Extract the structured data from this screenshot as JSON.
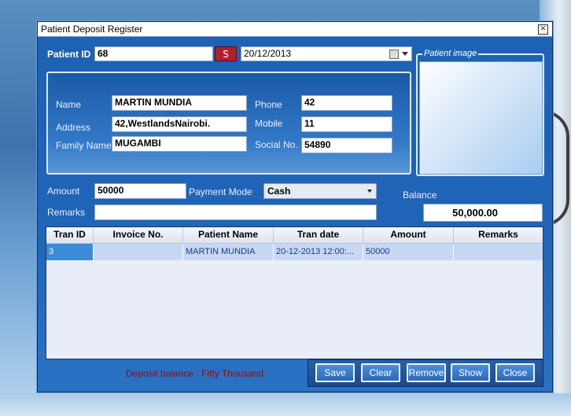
{
  "window": {
    "title": "Patient Deposit Register"
  },
  "header": {
    "patient_id_label": "Patient ID",
    "patient_id_value": "68",
    "search_button": "S",
    "date_value": "20/12/2013"
  },
  "patient": {
    "name_label": "Name",
    "name_value": "MARTIN MUNDIA",
    "address_label": "Address",
    "address_value": "42,WestlandsNairobi.",
    "family_label": "Family Name",
    "family_value": "MUGAMBI",
    "phone_label": "Phone",
    "phone_value": "42",
    "mobile_label": "Mobile",
    "mobile_value": "11",
    "social_label": "Social No.",
    "social_value": "54890"
  },
  "image_group": {
    "legend": "Patient image"
  },
  "payment": {
    "amount_label": "Amount",
    "amount_value": "50000",
    "mode_label": "Payment Mode",
    "mode_value": "Cash",
    "remarks_label": "Remarks",
    "remarks_value": "",
    "balance_label": "Balance",
    "balance_value": "50,000.00"
  },
  "grid": {
    "columns": [
      "Tran ID",
      "Invoice No.",
      "Patient Name",
      "Tran date",
      "Amount",
      "Remarks"
    ],
    "rows": [
      {
        "tran_id": "3",
        "invoice": "",
        "patient": "MARTIN MUNDIA",
        "date": "20-12-2013 12:00:...",
        "amount": "50000",
        "remarks": ""
      }
    ]
  },
  "footer": {
    "message": "Deposit balance : Fifty Thousand",
    "buttons": {
      "save": "Save",
      "clear": "Clear",
      "remove": "Remove",
      "show": "Show",
      "close": "Close"
    }
  },
  "colors": {
    "window_bg": "#1f64b6",
    "accent_red": "#b0202a",
    "message_red": "#8a0c10"
  }
}
